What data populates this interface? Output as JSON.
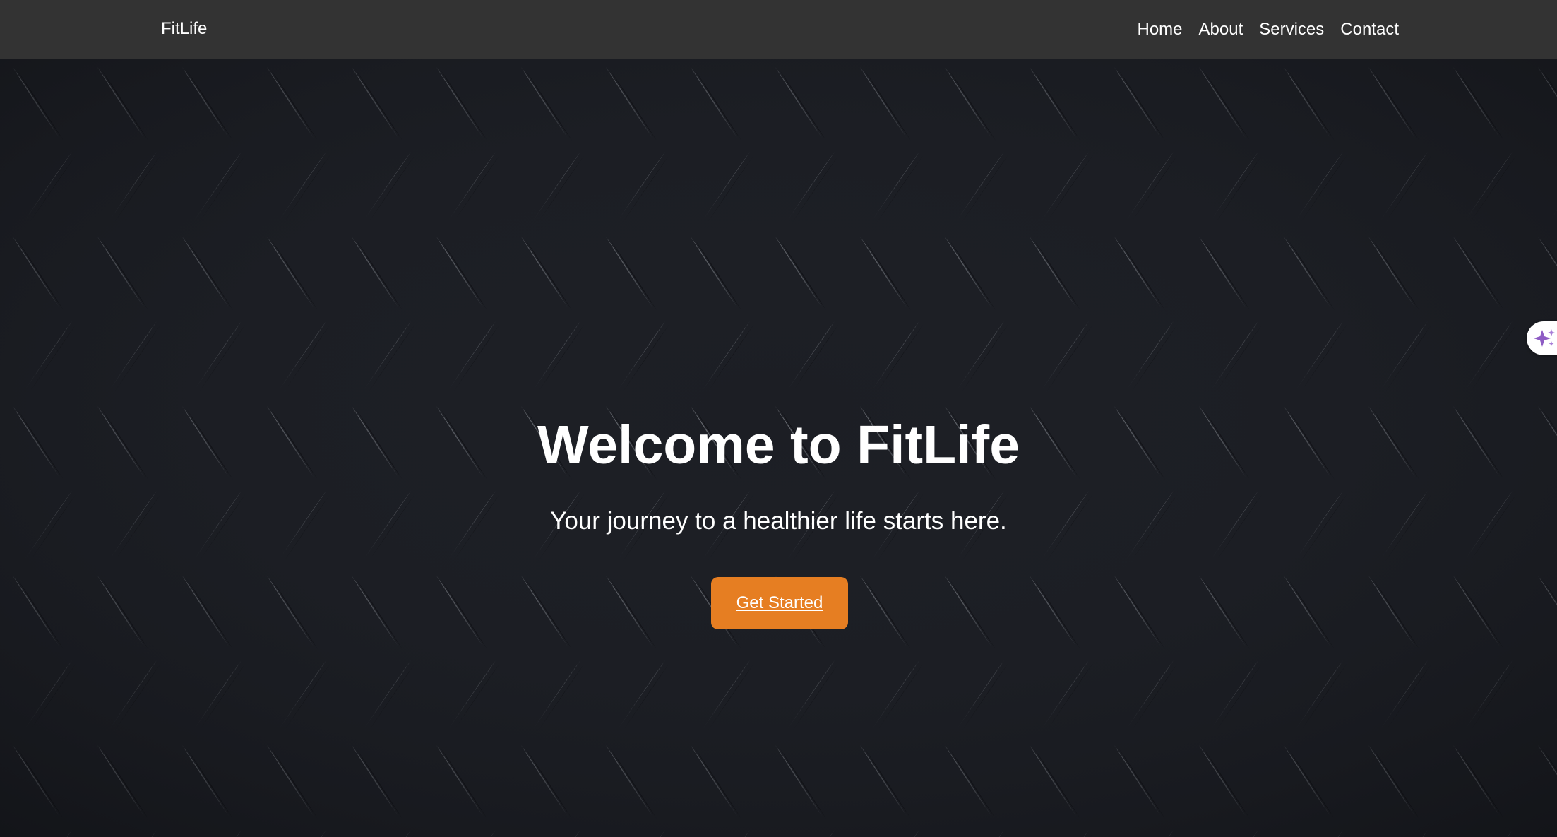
{
  "brand": {
    "name": "FitLife"
  },
  "nav": {
    "items": [
      "Home",
      "About",
      "Services",
      "Contact"
    ]
  },
  "hero": {
    "title": "Welcome to FitLife",
    "subtitle": "Your journey to a healthier life starts here.",
    "cta_label": "Get Started"
  },
  "colors": {
    "navbar_bg": "#333333",
    "accent": "#e67e22",
    "text": "#ffffff",
    "assist_icon": "#8e5cc4"
  },
  "icons": {
    "assist": "sparkle-icon"
  }
}
